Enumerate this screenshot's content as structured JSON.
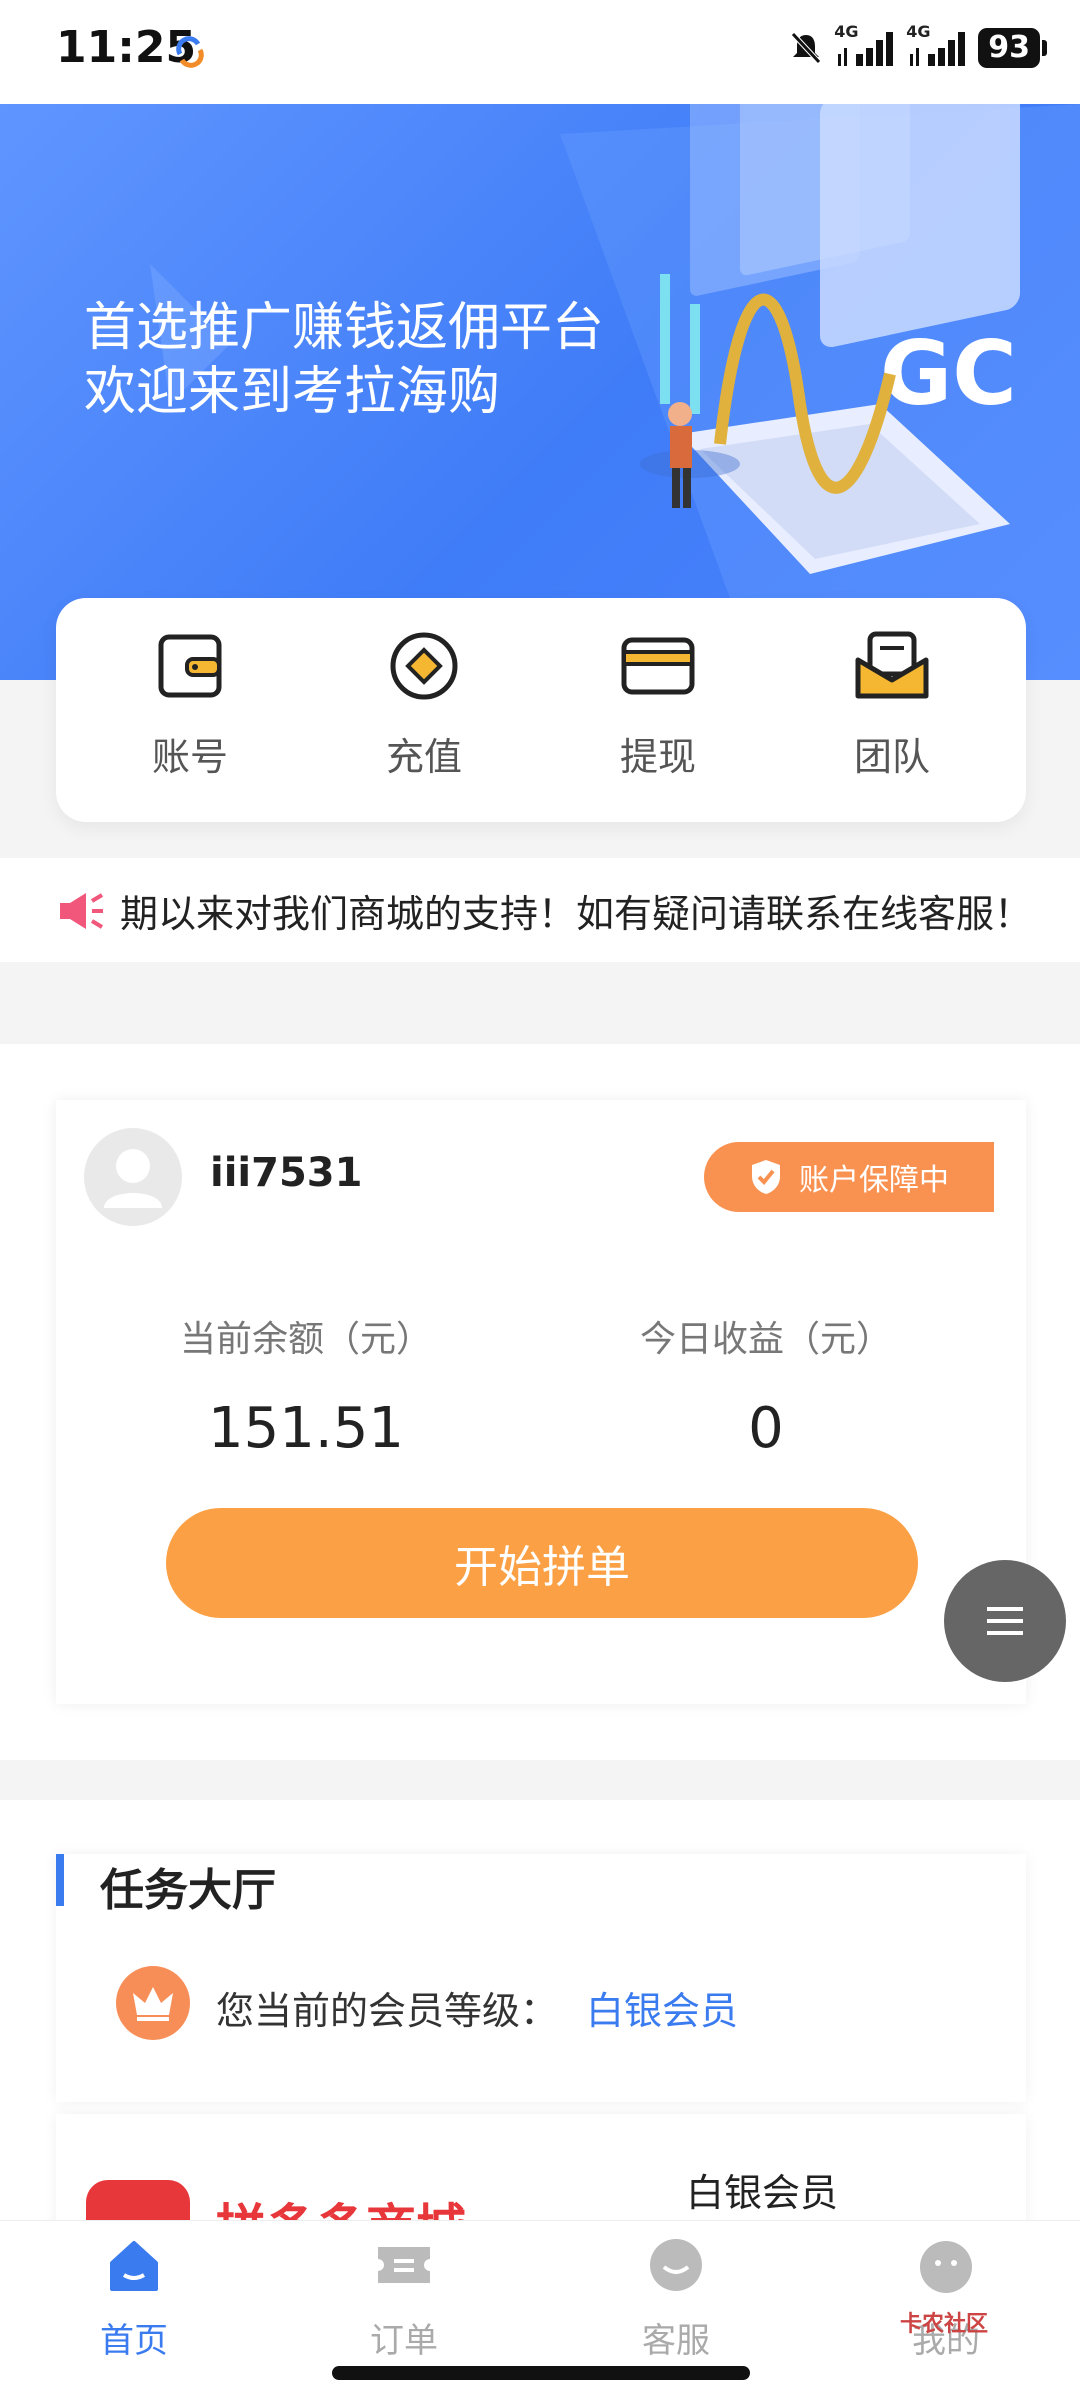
{
  "status_bar": {
    "time": "11:25",
    "network_1": "4G",
    "network_2": "4G",
    "battery": "93"
  },
  "banner": {
    "line1": "首选推广赚钱返佣平台",
    "line2": "欢迎来到考拉海购",
    "graphic_text": "GC"
  },
  "quick_actions": [
    {
      "label": "账号",
      "icon": "wallet-icon"
    },
    {
      "label": "充值",
      "icon": "recharge-icon"
    },
    {
      "label": "提现",
      "icon": "card-icon"
    },
    {
      "label": "团队",
      "icon": "envelope-icon"
    }
  ],
  "notice": {
    "text": "期以来对我们商城的支持！如有疑问请联系在线客服！"
  },
  "account": {
    "username": "iii7531",
    "protect_label": "账户保障中",
    "balance_label": "当前余额（元）",
    "balance_value": "151.51",
    "today_label": "今日收益（元）",
    "today_value": "0",
    "start_button": "开始拼单"
  },
  "task_hall": {
    "title": "任务大厅",
    "level_label": "您当前的会员等级：",
    "level_value": "白银会员"
  },
  "product": {
    "name": "拼多多商城",
    "level": "白银会员"
  },
  "tabbar": [
    {
      "label": "首页",
      "active": true
    },
    {
      "label": "订单",
      "active": false
    },
    {
      "label": "客服",
      "active": false
    },
    {
      "label": "我的",
      "active": false
    }
  ],
  "watermark": "卡农社区",
  "colors": {
    "primary": "#3a7bf0",
    "orange": "#fba044",
    "badge": "#f99150"
  }
}
